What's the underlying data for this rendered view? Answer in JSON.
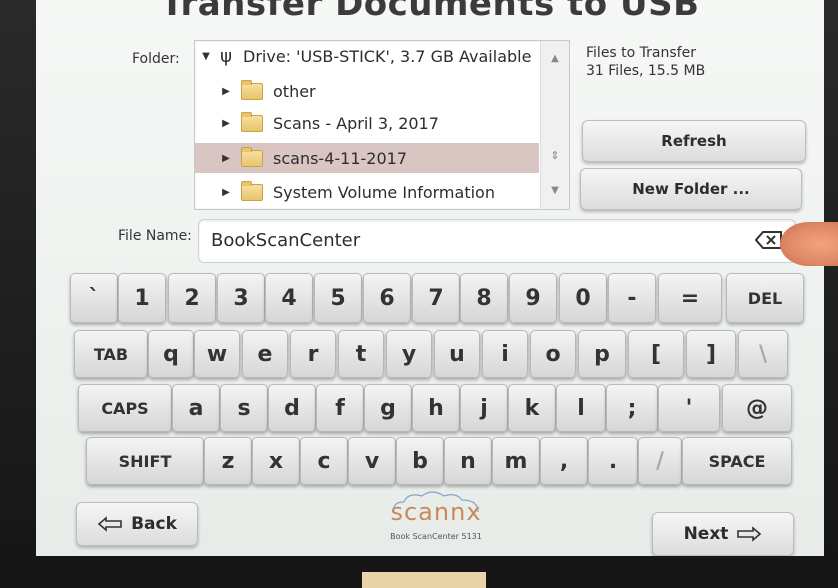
{
  "title": "Transfer Documents to USB",
  "folder_label": "Folder:",
  "tree": {
    "drive": "Drive: 'USB-STICK', 3.7 GB Available",
    "items": [
      {
        "label": "other"
      },
      {
        "label": "Scans - April 3, 2017"
      },
      {
        "label": "scans-4-11-2017",
        "selected": true
      },
      {
        "label": "System Volume Information"
      }
    ]
  },
  "files_to_transfer": {
    "heading": "Files to Transfer",
    "summary": "31 Files, 15.5 MB"
  },
  "buttons": {
    "refresh": "Refresh",
    "new_folder": "New Folder ...",
    "back": "Back",
    "next": "Next"
  },
  "file_name": {
    "label": "File Name:",
    "value": "BookScanCenter"
  },
  "keyboard": {
    "row1": [
      "`",
      "1",
      "2",
      "3",
      "4",
      "5",
      "6",
      "7",
      "8",
      "9",
      "0",
      "-",
      "=",
      "DEL"
    ],
    "row2": [
      "TAB",
      "q",
      "w",
      "e",
      "r",
      "t",
      "y",
      "u",
      "i",
      "o",
      "p",
      "[",
      "]",
      "\\"
    ],
    "row3": [
      "CAPS",
      "a",
      "s",
      "d",
      "f",
      "g",
      "h",
      "j",
      "k",
      "l",
      ";",
      "'",
      "@"
    ],
    "row4": [
      "SHIFT",
      "z",
      "x",
      "c",
      "v",
      "b",
      "n",
      "m",
      ",",
      ".",
      "/",
      "SPACE"
    ]
  },
  "brand": {
    "name": "scannx",
    "subtitle": "Book ScanCenter 5131"
  },
  "colors": {
    "selected_row": "#d9c5c2",
    "brand": "#c88a5a"
  }
}
